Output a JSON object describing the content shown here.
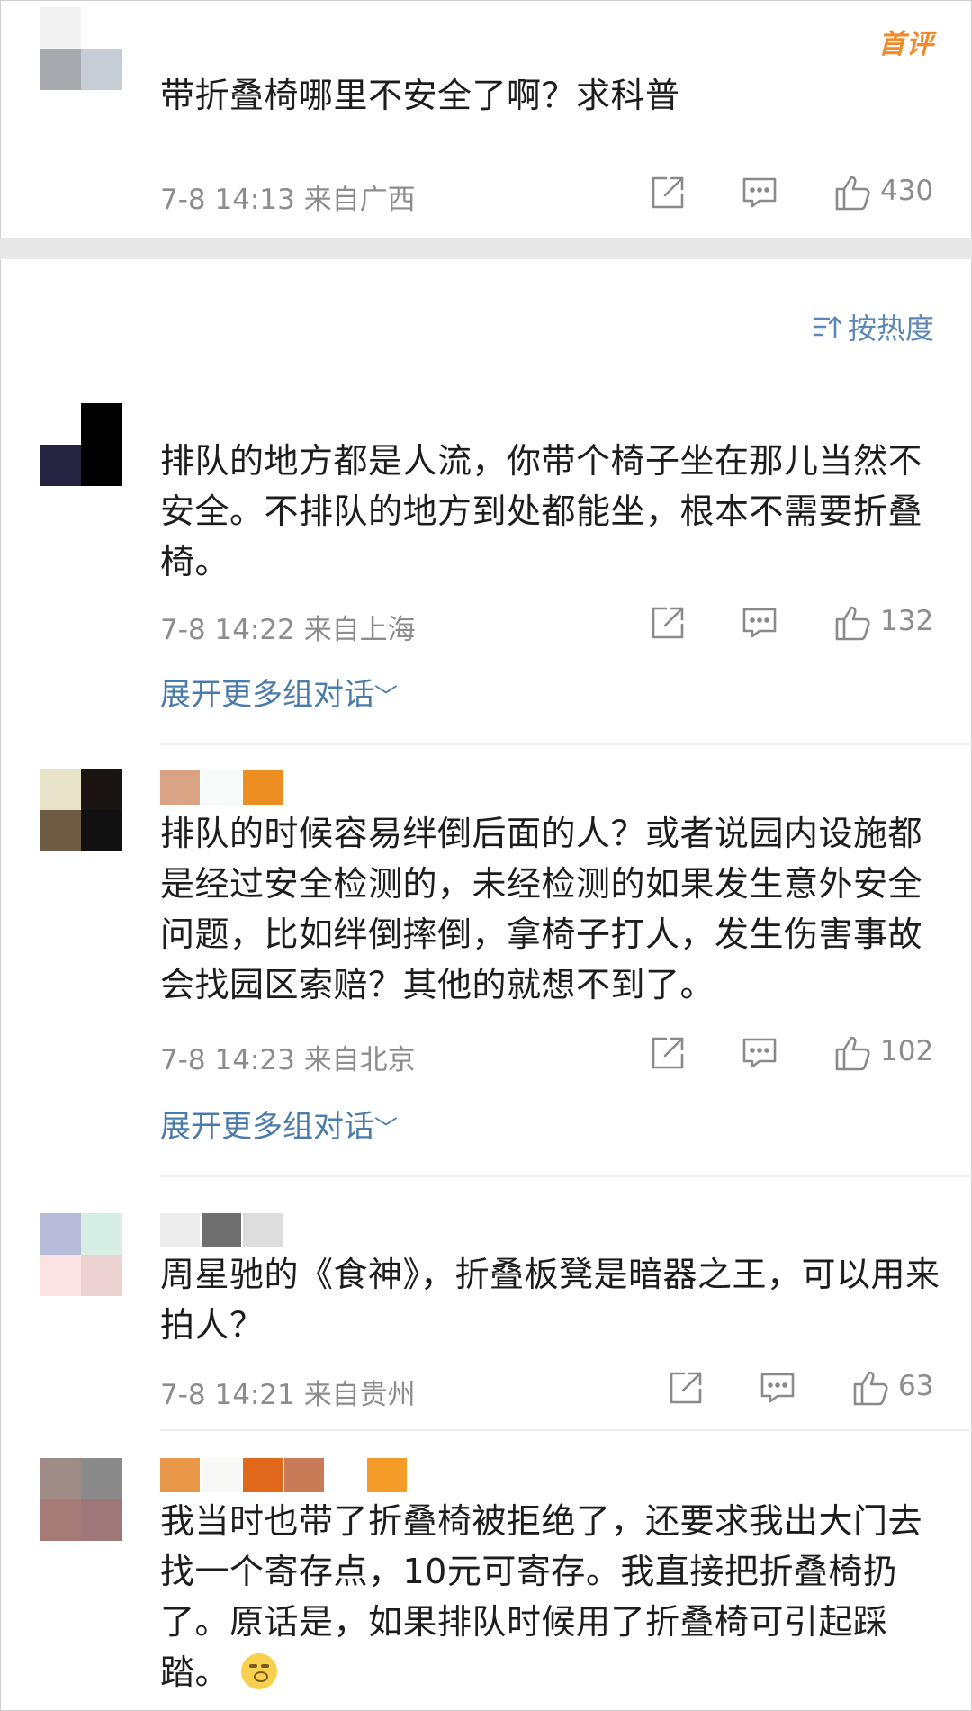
{
  "top_comment": {
    "badge": "首评",
    "text": "带折叠椅哪里不安全了啊？求科普",
    "time": "7-8 14:13",
    "location": "来自广西",
    "likes": "430",
    "avatar_colors": [
      "#f3f3f3",
      "#ffffff",
      "#a9aaaf",
      "#c7cdd4"
    ]
  },
  "sort": {
    "label": "按热度",
    "icon": "sort-icon"
  },
  "comments": [
    {
      "text": "排队的地方都是人流，你带个椅子坐在那儿当然不安全。不排队的地方到处都能坐，根本不需要折叠椅。",
      "time": "7-8 14:22",
      "location": "来自上海",
      "likes": "132",
      "expand": "展开更多组对话",
      "avatar_colors": [
        "#ffffff",
        "#000000",
        "#25233f",
        "#000000"
      ],
      "name_colors": [
        "#ffffff"
      ]
    },
    {
      "text": "排队的时候容易绊倒后面的人？或者说园内设施都是经过安全检测的，未经检测的如果发生意外安全问题，比如绊倒摔倒，拿椅子打人，发生伤害事故会找园区索赔？其他的就想不到了。",
      "time": "7-8 14:23",
      "location": "来自北京",
      "likes": "102",
      "expand": "展开更多组对话",
      "avatar_colors": [
        "#e6e3c8",
        "#1a1513",
        "#6f5c45",
        "#111111"
      ],
      "name_colors": [
        "#d9a384",
        "#f6fbf9",
        "#ec8e22"
      ]
    },
    {
      "text": "周星驰的《食神》，折叠板凳是暗器之王，可以用来拍人？",
      "time": "7-8 14:21",
      "location": "来自贵州",
      "likes": "63",
      "avatar_colors": [
        "#b6bbd9",
        "#d7eee7",
        "#fbe2e3",
        "#ecd3d1"
      ],
      "name_colors": [
        "#ededed",
        "#6f6f6f",
        "#dddddd"
      ]
    },
    {
      "text": "我当时也带了折叠椅被拒绝了，还要求我出大门去找一个寄存点，10元可寄存。我直接把折叠椅扔了。原话是，如果排队时候用了折叠椅可引起踩踏。",
      "emoji": "pensive-face-emoji",
      "avatar_colors": [
        "#a08c86",
        "#8a8a8a",
        "#a57b77",
        "#9f7779"
      ],
      "name_colors": [
        "#e99748",
        "#f8f8f6",
        "#e0681b",
        "#c97a56",
        "#ffffff",
        "#f49b28"
      ]
    }
  ]
}
